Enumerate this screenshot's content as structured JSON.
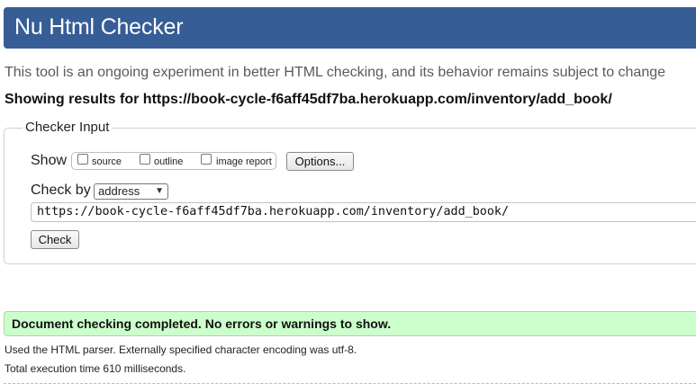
{
  "header": {
    "title": "Nu Html Checker"
  },
  "intro": "This tool is an ongoing experiment in better HTML checking, and its behavior remains subject to change",
  "showing_results": "Showing results for https://book-cycle-f6aff45df7ba.herokuapp.com/inventory/add_book/",
  "checker_input": {
    "legend": "Checker Input",
    "show_label": "Show",
    "show_options": [
      {
        "label": "source",
        "checked": false
      },
      {
        "label": "outline",
        "checked": false
      },
      {
        "label": "image report",
        "checked": false
      }
    ],
    "options_button": "Options...",
    "check_by_label": "Check by",
    "check_by_value": "address",
    "url_value": "https://book-cycle-f6aff45df7ba.herokuapp.com/inventory/add_book/",
    "check_button": "Check"
  },
  "result": {
    "message": "Document checking completed. No errors or warnings to show.",
    "parser_note": "Used the HTML parser. Externally specified character encoding was utf-8.",
    "execution_time": "Total execution time 610 milliseconds."
  },
  "colors": {
    "header_bg": "#365d95",
    "success_bg": "#ccffcc"
  }
}
